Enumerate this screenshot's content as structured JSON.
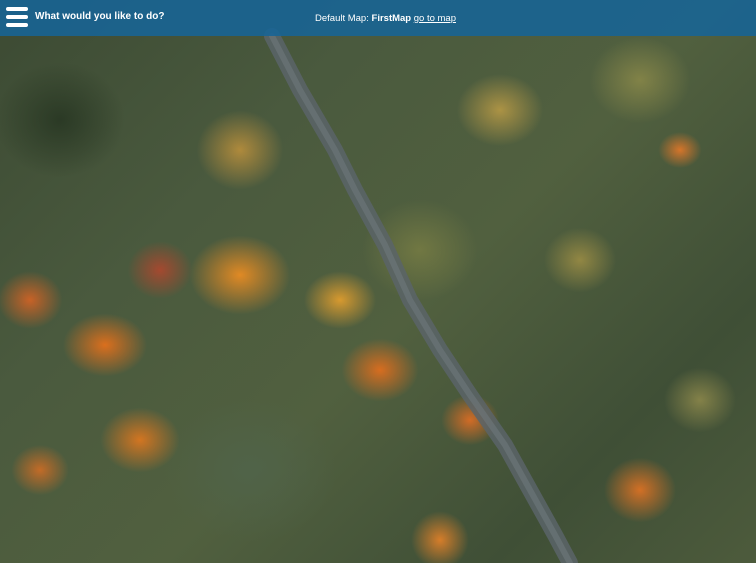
{
  "header": {
    "menu_icon": "hamburger-menu-icon",
    "question": "What would you like to do?",
    "default_map_label": "Default Map:",
    "map_name": "FirstMap",
    "go_to_map_link": "go to map",
    "bar_color": "#1764a0"
  },
  "background": {
    "image": "aerial-autumn-forest-with-road"
  }
}
